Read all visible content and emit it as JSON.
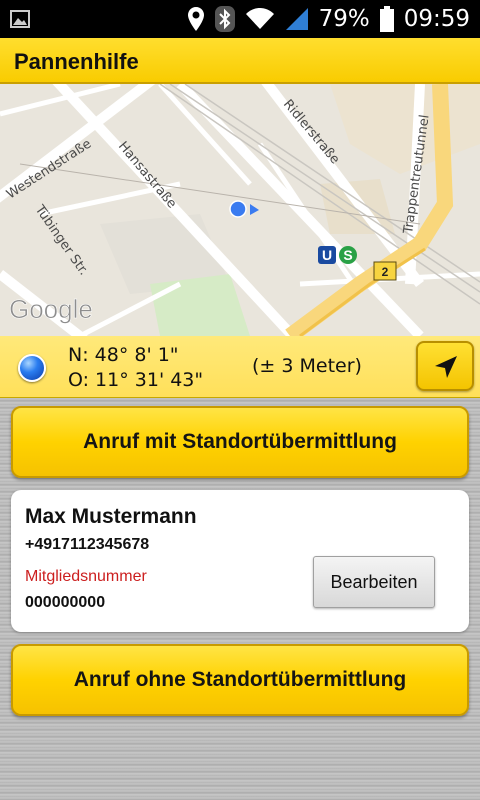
{
  "status_bar": {
    "battery_percent": "79%",
    "time": "09:59",
    "icons": [
      "image-icon",
      "location-icon",
      "bluetooth-icon",
      "wifi-icon",
      "signal-icon",
      "battery-icon"
    ]
  },
  "app": {
    "title": "Pannenhilfe",
    "accent_color": "#ffd200"
  },
  "map": {
    "provider_logo": "Google",
    "street_labels": {
      "westendstrasse": "Westendstraße",
      "hansastrasse": "Hansastraße",
      "tuebinger": "Tübinger Str.",
      "ridlerstrasse": "Ridlerstraße",
      "trappentreutunnel": "Trappentreutunnel"
    },
    "transit_badges": [
      "U",
      "S"
    ],
    "road_number": "2"
  },
  "location": {
    "north": "N: 48° 8' 1\"",
    "east": "O: 11° 31' 43\"",
    "accuracy": "(± 3 Meter)"
  },
  "buttons": {
    "call_with_location": "Anruf mit Standortübermittlung",
    "call_without_location": "Anruf ohne Standortübermittlung",
    "edit": "Bearbeiten"
  },
  "contact": {
    "name": "Max Mustermann",
    "phone": "+4917112345678",
    "member_label": "Mitgliedsnummer",
    "member_number": "000000000"
  }
}
